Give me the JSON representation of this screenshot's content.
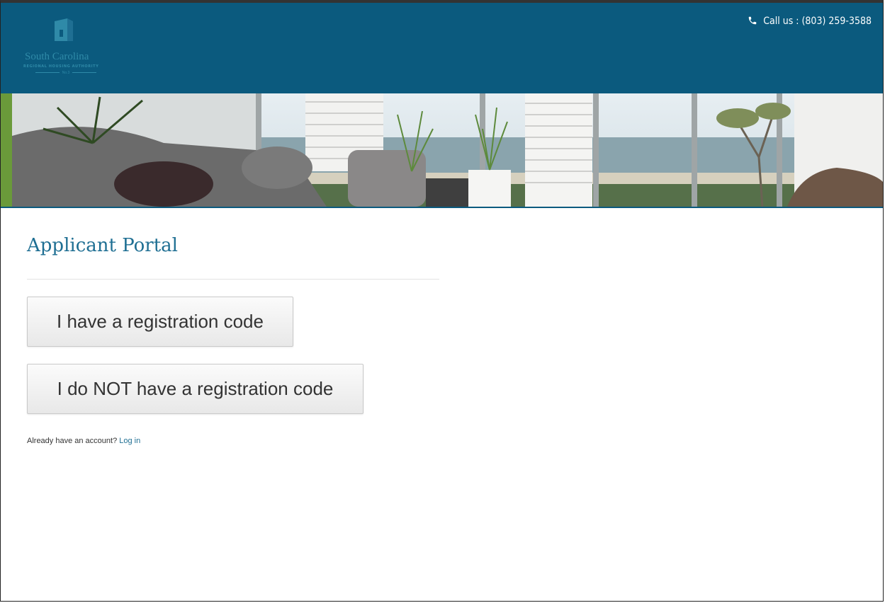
{
  "header": {
    "logo": {
      "line1": "South Carolina",
      "line2": "REGIONAL HOUSING AUTHORITY",
      "line3": "No.3"
    },
    "phone_label": "Call us : (803) 259-3588",
    "phone_icon": "phone-icon"
  },
  "hero": {
    "image": "living-room-ocean-view-banner"
  },
  "main": {
    "title": "Applicant Portal",
    "buttons": {
      "have_code": "I have a registration code",
      "no_code": "I do NOT have a registration code"
    },
    "login_prompt": "Already have an account?",
    "login_link": "Log in"
  },
  "colors": {
    "header_bg": "#0b5a7e",
    "title": "#1f6f93",
    "link": "#1f6f93",
    "logo": "#2f8aa8"
  }
}
